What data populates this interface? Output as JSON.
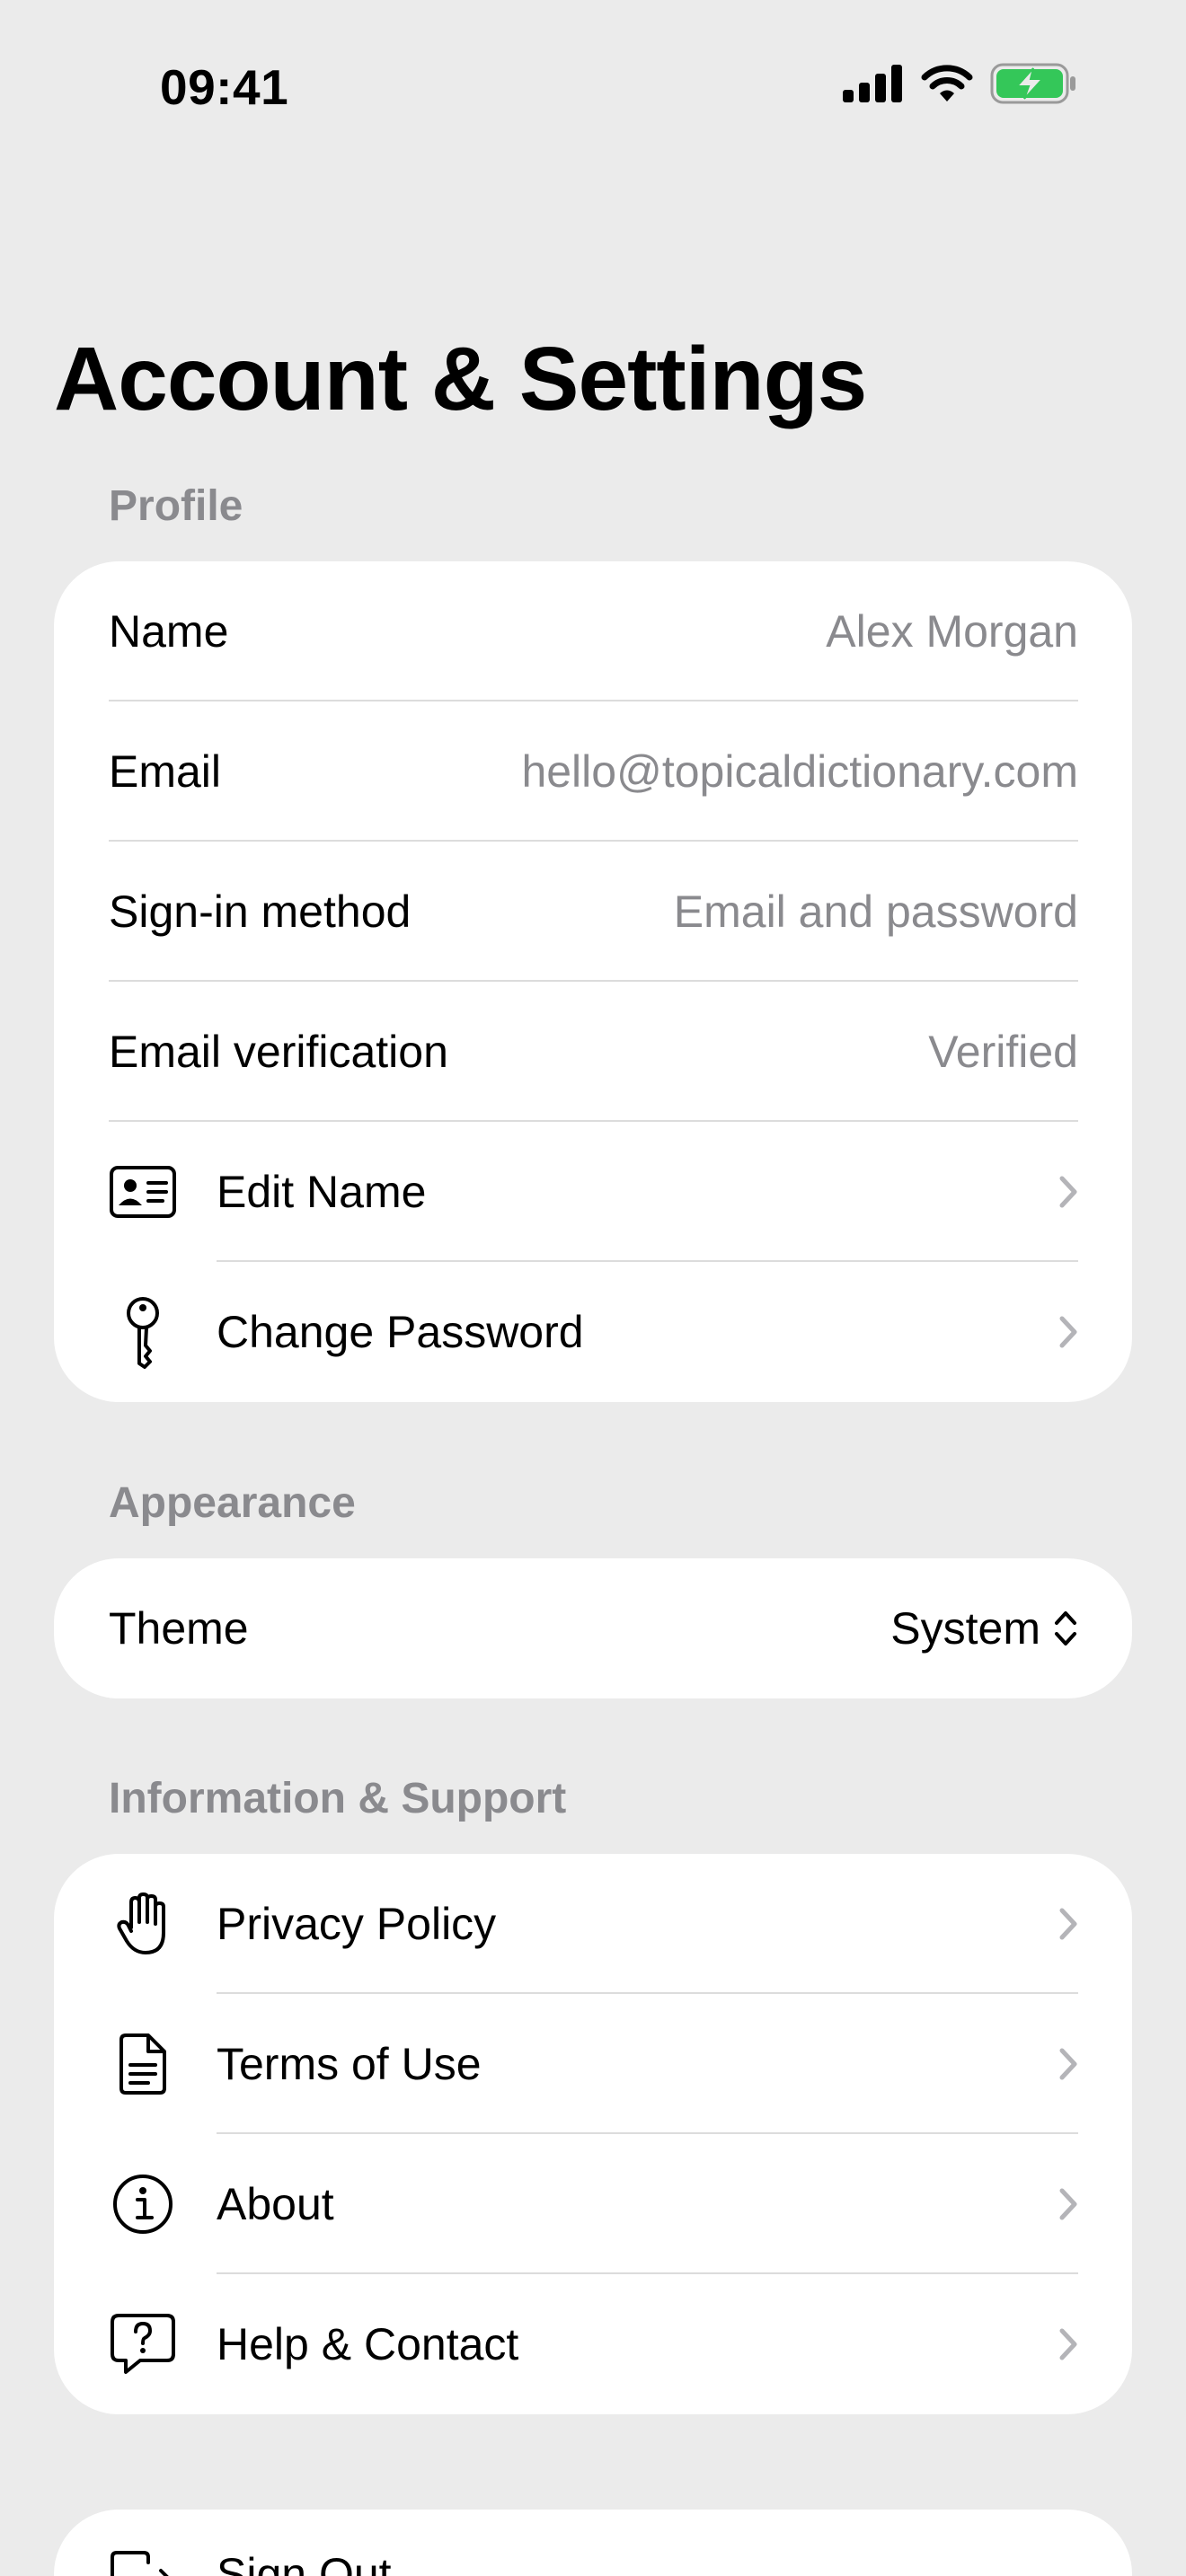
{
  "status_bar": {
    "time": "09:41",
    "signal_icon": "cellular-signal-icon",
    "wifi_icon": "wifi-icon",
    "battery_icon": "battery-charging-icon",
    "battery_color": "#34c759"
  },
  "title": "Account & Settings",
  "profile": {
    "header": "Profile",
    "rows": [
      {
        "label": "Name",
        "value": "Alex Morgan"
      },
      {
        "label": "Email",
        "value": "hello@topicaldictionary.com"
      },
      {
        "label": "Sign-in method",
        "value": "Email and password"
      },
      {
        "label": "Email verification",
        "value": "Verified"
      }
    ],
    "actions": [
      {
        "label": "Edit Name",
        "icon": "id-card-icon"
      },
      {
        "label": "Change Password",
        "icon": "key-icon"
      }
    ]
  },
  "appearance": {
    "header": "Appearance",
    "theme_label": "Theme",
    "theme_value": "System"
  },
  "support": {
    "header": "Information & Support",
    "items": [
      {
        "label": "Privacy Policy",
        "icon": "hand-raised-icon"
      },
      {
        "label": "Terms of Use",
        "icon": "document-icon"
      },
      {
        "label": "About",
        "icon": "info-circle-icon"
      },
      {
        "label": "Help & Contact",
        "icon": "question-bubble-icon"
      }
    ]
  },
  "account": {
    "sign_out_label": "Sign Out",
    "sign_out_icon": "sign-out-icon"
  },
  "colors": {
    "background": "#ebebeb",
    "card": "#ffffff",
    "secondary_text": "#8a8a8e",
    "chevron": "#b4b4b8"
  }
}
